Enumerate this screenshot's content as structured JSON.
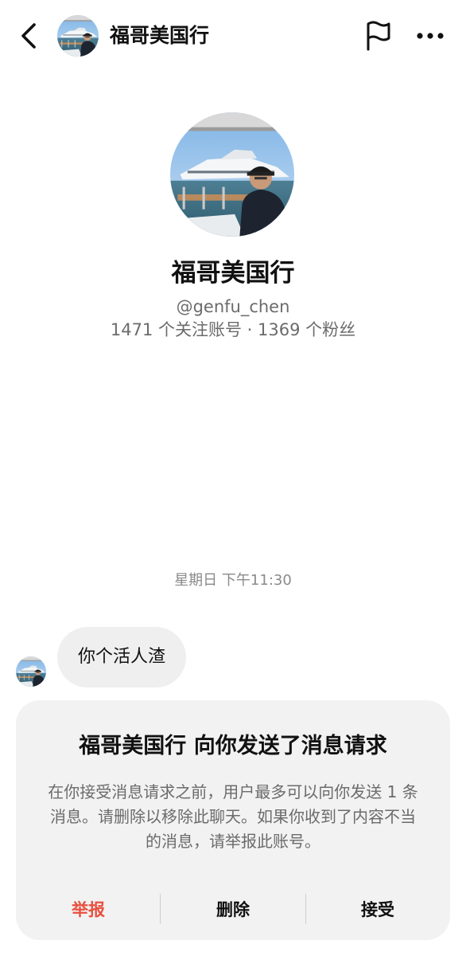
{
  "header": {
    "back_icon": "chevron-left-icon",
    "title": "福哥美国行",
    "flag_icon": "flag-icon",
    "more_icon": "more-horizontal-icon"
  },
  "profile": {
    "name": "福哥美国行",
    "handle": "@genfu_chen",
    "stats": "1471 个关注账号 · 1369 个粉丝"
  },
  "chat": {
    "timestamp": "星期日 下午11:30",
    "messages": [
      {
        "text": "你个活人渣",
        "from": "other"
      }
    ]
  },
  "request": {
    "title": "福哥美国行 向你发送了消息请求",
    "description": "在你接受消息请求之前，用户最多可以向你发送 1 条消息。请删除以移除此聊天。如果你收到了内容不当的消息，请举报此账号。",
    "actions": {
      "report": "举报",
      "delete": "删除",
      "accept": "接受"
    }
  },
  "colors": {
    "report": "#e8503f",
    "card_background": "#f2f2f2",
    "bubble_background": "#efefef",
    "secondary_text": "#6b6b6b"
  }
}
